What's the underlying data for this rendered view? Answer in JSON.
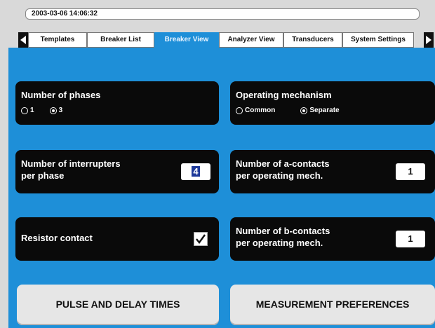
{
  "header": {
    "datetime": "2003-03-06 14:06:32"
  },
  "tabs": [
    {
      "label": "Templates",
      "active": false
    },
    {
      "label": "Breaker List",
      "active": false
    },
    {
      "label": "Breaker View",
      "active": true
    },
    {
      "label": "Analyzer View",
      "active": false
    },
    {
      "label": "Transducers",
      "active": false
    },
    {
      "label": "System Settings",
      "active": false
    }
  ],
  "panels": {
    "phases": {
      "title": "Number of phases",
      "options": [
        "1",
        "3"
      ],
      "selected": "3"
    },
    "operating_mechanism": {
      "title": "Operating mechanism",
      "options": [
        "Common",
        "Separate"
      ],
      "selected": "Separate"
    },
    "interrupters": {
      "title_line1": "Number of interrupters",
      "title_line2": "per phase",
      "value": "4"
    },
    "a_contacts": {
      "title_line1": "Number of a-contacts",
      "title_line2": "per operating mech.",
      "value": "1"
    },
    "resistor": {
      "title": "Resistor contact",
      "checked": true
    },
    "b_contacts": {
      "title_line1": "Number of b-contacts",
      "title_line2": "per operating mech.",
      "value": "1"
    }
  },
  "buttons": {
    "pulse": "PULSE AND DELAY TIMES",
    "measurement": "MEASUREMENT PREFERENCES"
  },
  "colors": {
    "accent": "#1e8fd8",
    "panel": "#0a0a0a",
    "selection": "#1f3a9a"
  }
}
